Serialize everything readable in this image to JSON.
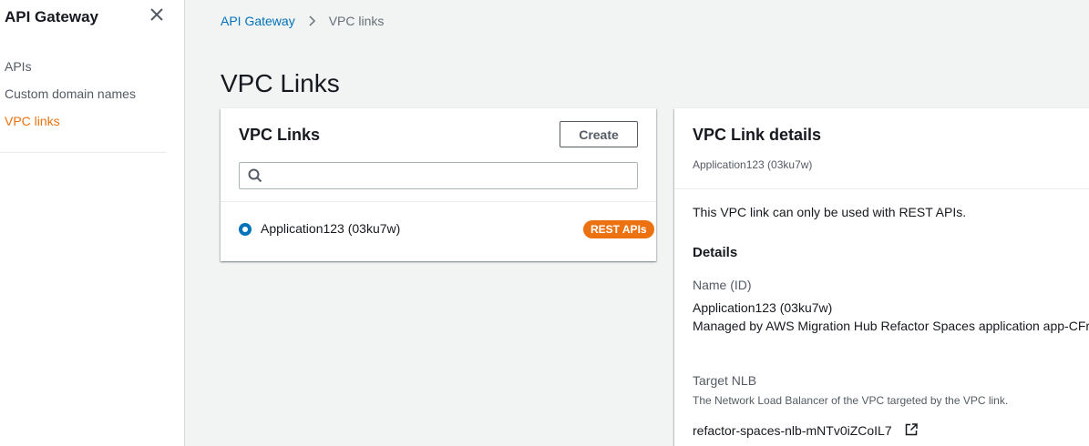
{
  "sidebar": {
    "title": "API Gateway",
    "items": [
      {
        "label": "APIs"
      },
      {
        "label": "Custom domain names"
      },
      {
        "label": "VPC links"
      }
    ]
  },
  "breadcrumb": {
    "root": "API Gateway",
    "current": "VPC links"
  },
  "page_title": "VPC Links",
  "left_panel": {
    "title": "VPC Links",
    "create_label": "Create",
    "search_placeholder": "",
    "rows": [
      {
        "label": "Application123 (03ku7w)",
        "badge": "REST APIs",
        "selected": true
      }
    ]
  },
  "right_panel": {
    "title": "VPC Link details",
    "subtitle": "Application123 (03ku7w)",
    "note": "This VPC link can only be used with REST APIs.",
    "details_heading": "Details",
    "name_key": "Name (ID)",
    "name_value": "Application123 (03ku7w)",
    "managed_text": "Managed by AWS Migration Hub Refactor Spaces application app-CFr",
    "target_key": "Target NLB",
    "target_desc": "The Network Load Balancer of the VPC targeted by the VPC link.",
    "target_value": "refactor-spaces-nlb-mNTv0iZCoIL7"
  },
  "colors": {
    "accent": "#ec7211",
    "link": "#0073bb",
    "background": "#f2f3f3"
  }
}
